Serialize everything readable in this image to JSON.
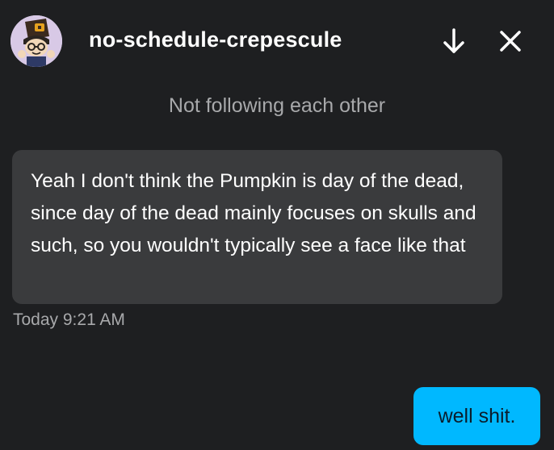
{
  "conversation": {
    "username": "no-schedule-crepescule",
    "follow_status": "Not following each other"
  },
  "icons": {
    "avatar": "avatar-image",
    "scroll_down": "arrow-down-icon",
    "close": "close-icon"
  },
  "messages": [
    {
      "direction": "incoming",
      "text": "Yeah I don't think the Pumpkin is day of the dead, since day of the dead mainly focuses on skulls and such, so you wouldn't typically see a face like that",
      "timestamp": "Today 9:21 AM"
    },
    {
      "direction": "outgoing",
      "text": "well shit."
    }
  ],
  "colors": {
    "background": "#1e1f21",
    "incoming_bubble": "#3a3b3d",
    "outgoing_bubble": "#00b8ff",
    "muted_text": "#a8a9ab"
  }
}
